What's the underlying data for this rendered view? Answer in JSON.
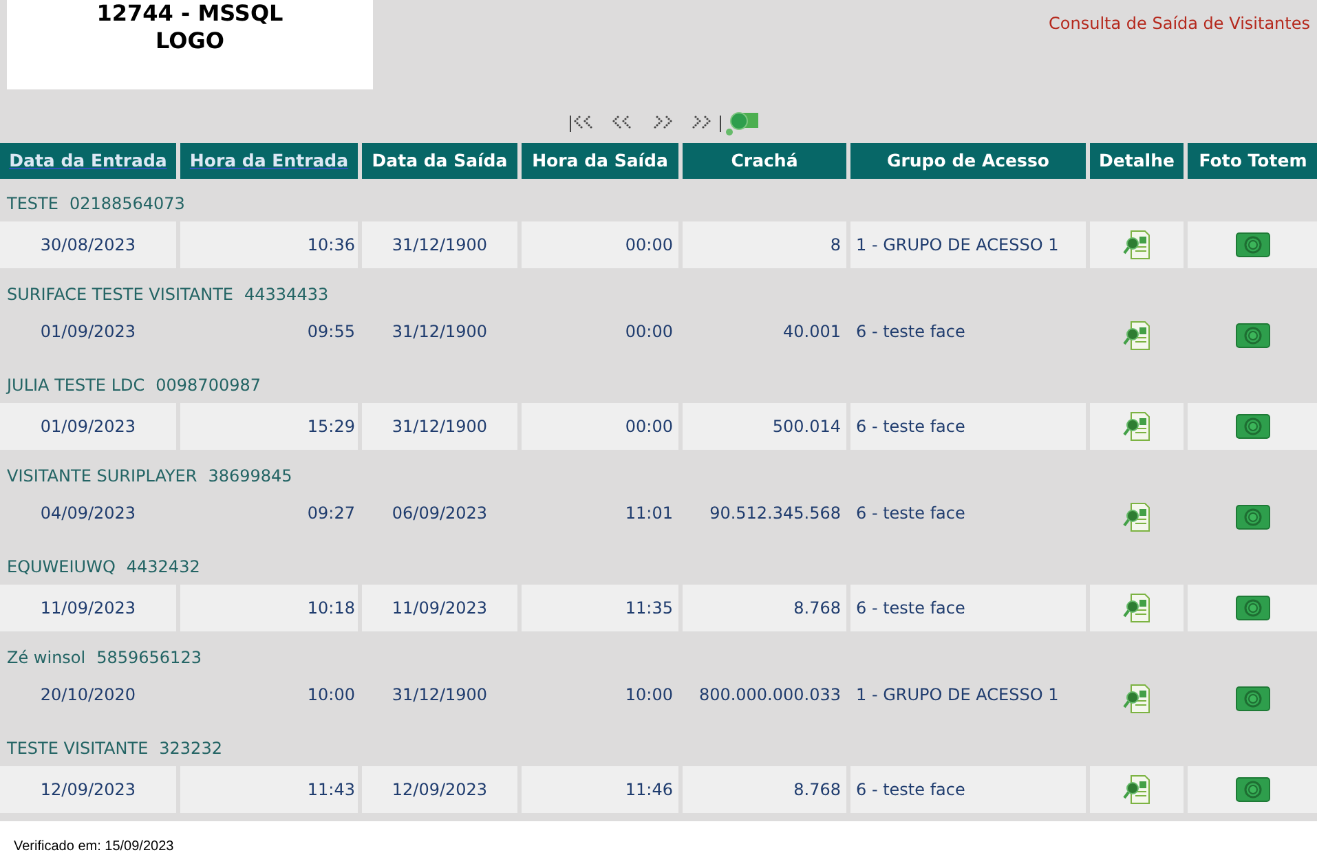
{
  "logo": {
    "lines": [
      "12744 - MSSQL",
      "LOGO"
    ]
  },
  "page_title": "Consulta de Saída de Visitantes",
  "table": {
    "columns": [
      {
        "label": "Data da Entrada",
        "sortable": true
      },
      {
        "label": "Hora da Entrada",
        "sortable": true
      },
      {
        "label": "Data da Saída",
        "sortable": false
      },
      {
        "label": "Hora da Saída",
        "sortable": false
      },
      {
        "label": "Crachá",
        "sortable": false
      },
      {
        "label": "Grupo de Acesso",
        "sortable": false
      },
      {
        "label": "Detalhe",
        "sortable": false
      },
      {
        "label": "Foto Totem",
        "sortable": false
      }
    ],
    "rows": [
      {
        "name": "TESTE",
        "document": "02188564073",
        "entry_date": "30/08/2023",
        "entry_time": "10:36",
        "exit_date": "31/12/1900",
        "exit_time": "00:00",
        "badge": "8",
        "group": "1 - GRUPO DE ACESSO 1"
      },
      {
        "name": "SURIFACE TESTE VISITANTE",
        "document": "44334433",
        "entry_date": "01/09/2023",
        "entry_time": "09:55",
        "exit_date": "31/12/1900",
        "exit_time": "00:00",
        "badge": "40.001",
        "group": "6 - teste face"
      },
      {
        "name": "JULIA TESTE LDC",
        "document": "0098700987",
        "entry_date": "01/09/2023",
        "entry_time": "15:29",
        "exit_date": "31/12/1900",
        "exit_time": "00:00",
        "badge": "500.014",
        "group": "6 - teste face"
      },
      {
        "name": "VISITANTE SURIPLAYER",
        "document": "38699845",
        "entry_date": "04/09/2023",
        "entry_time": "09:27",
        "exit_date": "06/09/2023",
        "exit_time": "11:01",
        "badge": "90.512.345.568",
        "group": "6 - teste face"
      },
      {
        "name": "EQUWEIUWQ",
        "document": "4432432",
        "entry_date": "11/09/2023",
        "entry_time": "10:18",
        "exit_date": "11/09/2023",
        "exit_time": "11:35",
        "badge": "8.768",
        "group": "6 - teste face"
      },
      {
        "name": "Zé winsol",
        "document": "5859656123",
        "entry_date": "20/10/2020",
        "entry_time": "10:00",
        "exit_date": "31/12/1900",
        "exit_time": "10:00",
        "badge": "800.000.000.033",
        "group": "1 - GRUPO DE ACESSO 1"
      },
      {
        "name": "TESTE VISITANTE",
        "document": "323232",
        "entry_date": "12/09/2023",
        "entry_time": "11:43",
        "exit_date": "12/09/2023",
        "exit_time": "11:46",
        "badge": "8.768",
        "group": "6 - teste face"
      }
    ]
  },
  "footer": "Verificado em: 15/09/2023"
}
